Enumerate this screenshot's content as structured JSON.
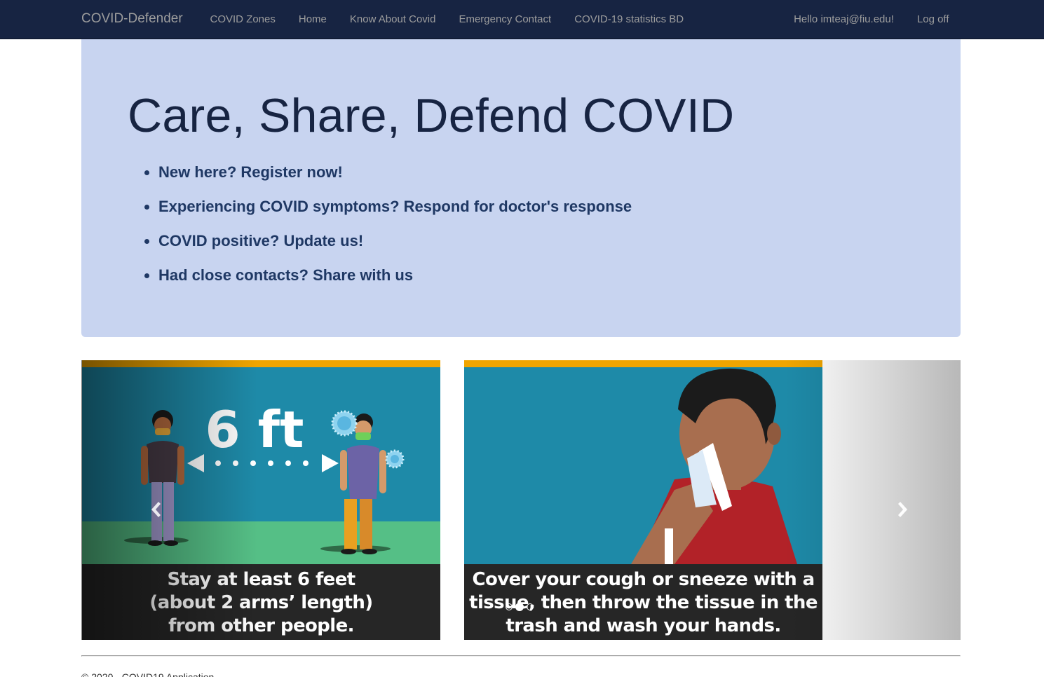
{
  "nav": {
    "brand": "COVID-Defender",
    "links": [
      "COVID Zones",
      "Home",
      "Know About Covid",
      "Emergency Contact",
      "COVID-19 statistics BD"
    ],
    "greeting": "Hello imteaj@fiu.edu!",
    "logoff": "Log off"
  },
  "hero": {
    "title": "Care, Share, Defend COVID",
    "items": [
      "New here? Register now!",
      "Experiencing COVID symptoms? Respond for doctor's response",
      "COVID positive? Update us!",
      "Had close contacts? Share with us"
    ]
  },
  "carousel": {
    "slides": [
      {
        "distance_label": "6 ft",
        "caption_lines": [
          "Stay at least 6 feet",
          "(about 2 arms’ length)",
          "from other people."
        ]
      },
      {
        "caption_lines": [
          "Cover your cough or sneeze with a",
          "tissue, then throw the tissue in the",
          "trash and wash your hands."
        ]
      }
    ],
    "indicator_count": 3,
    "active_indicator": 1,
    "prev_icon": "chevron-left-icon",
    "next_icon": "chevron-right-icon"
  },
  "footer": {
    "text": "© 2020 - COVID19 Application"
  },
  "colors": {
    "navbar": "#172442",
    "hero_background": "#c8d4f0",
    "title": "#172442",
    "list_text": "#1f3864",
    "poster_teal": "#1e8aa8",
    "poster_orange": "#f0a500",
    "caption_background": "#262626"
  }
}
